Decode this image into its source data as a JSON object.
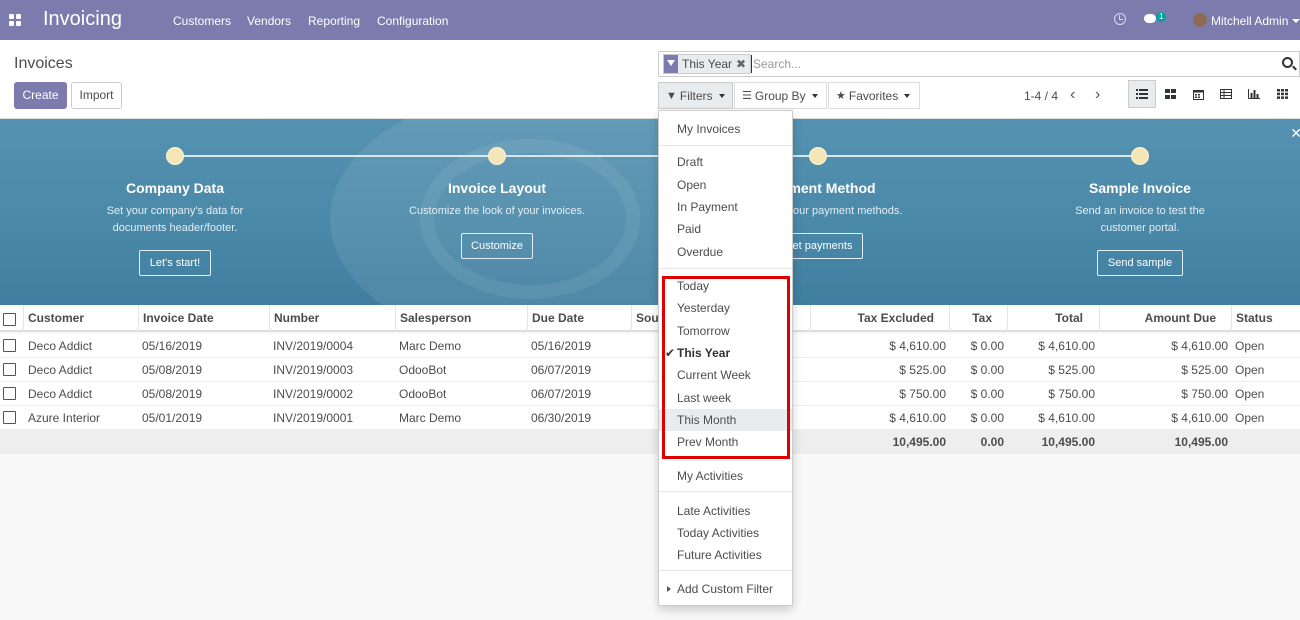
{
  "navbar": {
    "app_name": "Invoicing",
    "menu": [
      "Customers",
      "Vendors",
      "Reporting",
      "Configuration"
    ],
    "chat_badge": "1",
    "user": "Mitchell Admin"
  },
  "control": {
    "breadcrumb": "Invoices",
    "create_label": "Create",
    "import_label": "Import",
    "search": {
      "facet": "This Year",
      "placeholder": "Search..."
    },
    "filters_label": "Filters",
    "groupby_label": "Group By",
    "favorites_label": "Favorites",
    "pager": "1-4 / 4"
  },
  "banner": {
    "steps": [
      {
        "title": "Company Data",
        "desc1": "Set your company's data for",
        "desc2": "documents header/footer.",
        "button": "Let's start!"
      },
      {
        "title": "Invoice Layout",
        "desc1": "Customize the look of your invoices.",
        "desc2": "",
        "button": "Customize"
      },
      {
        "title": "ment Method",
        "desc1": "your payment methods.",
        "desc2": "",
        "button": "et payments"
      },
      {
        "title": "Sample Invoice",
        "desc1": "Send an invoice to test the",
        "desc2": "customer portal.",
        "button": "Send sample"
      }
    ]
  },
  "table": {
    "columns": [
      "Customer",
      "Invoice Date",
      "Number",
      "Salesperson",
      "Due Date",
      "Sou",
      "Tax Excluded",
      "Tax",
      "Total",
      "Amount Due",
      "Status"
    ],
    "rows": [
      {
        "customer": "Deco Addict",
        "date": "05/16/2019",
        "number": "INV/2019/0004",
        "salesperson": "Marc Demo",
        "due": "05/16/2019",
        "tax_excluded": "$ 4,610.00",
        "tax": "$ 0.00",
        "total": "$ 4,610.00",
        "amount_due": "$ 4,610.00",
        "status": "Open"
      },
      {
        "customer": "Deco Addict",
        "date": "05/08/2019",
        "number": "INV/2019/0003",
        "salesperson": "OdooBot",
        "due": "06/07/2019",
        "tax_excluded": "$ 525.00",
        "tax": "$ 0.00",
        "total": "$ 525.00",
        "amount_due": "$ 525.00",
        "status": "Open"
      },
      {
        "customer": "Deco Addict",
        "date": "05/08/2019",
        "number": "INV/2019/0002",
        "salesperson": "OdooBot",
        "due": "06/07/2019",
        "tax_excluded": "$ 750.00",
        "tax": "$ 0.00",
        "total": "$ 750.00",
        "amount_due": "$ 750.00",
        "status": "Open"
      },
      {
        "customer": "Azure Interior",
        "date": "05/01/2019",
        "number": "INV/2019/0001",
        "salesperson": "Marc Demo",
        "due": "06/30/2019",
        "tax_excluded": "$ 4,610.00",
        "tax": "$ 0.00",
        "total": "$ 4,610.00",
        "amount_due": "$ 4,610.00",
        "status": "Open"
      }
    ],
    "totals": {
      "tax_excluded": "10,495.00",
      "tax": "0.00",
      "total": "10,495.00",
      "amount_due": "10,495.00"
    }
  },
  "filters_menu": {
    "my_invoices": "My Invoices",
    "states": [
      "Draft",
      "Open",
      "In Payment",
      "Paid",
      "Overdue"
    ],
    "dates": [
      "Today",
      "Yesterday",
      "Tomorrow",
      "This Year",
      "Current Week",
      "Last week",
      "This Month",
      "Prev Month"
    ],
    "checked": "This Year",
    "hovered": "This Month",
    "my_activities": "My Activities",
    "activities": [
      "Late Activities",
      "Today Activities",
      "Future Activities"
    ],
    "custom": "Add Custom Filter"
  }
}
